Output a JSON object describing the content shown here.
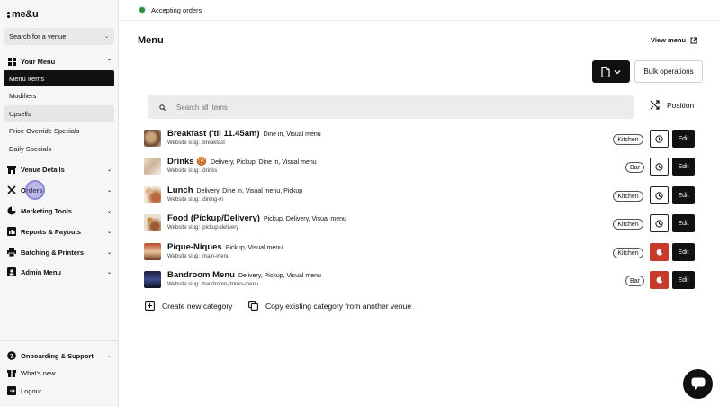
{
  "brand": {
    "logo_text": "me&u"
  },
  "sidebar": {
    "venue_placeholder": "Search for a venue",
    "sections": {
      "your_menu": "Your Menu",
      "venue_details": "Venue Details",
      "orders": "Orders",
      "marketing_tools": "Marketing Tools",
      "reports_payouts": "Reports & Payouts",
      "batching_printers": "Batching & Printers",
      "admin_menu": "Admin Menu"
    },
    "sub_items": [
      "Menu Items",
      "Modifiers",
      "Upsells",
      "Price Override Specials",
      "Daily Specials"
    ],
    "footer": {
      "onboarding": "Onboarding & Support",
      "whats_new": "What's new",
      "logout": "Logout"
    }
  },
  "topbar": {
    "status": "Accepting orders",
    "status_color": "#2e8b3e"
  },
  "main": {
    "title": "Menu",
    "view_menu": "View menu",
    "bulk_operations": "Bulk operations",
    "search_placeholder": "Search all items",
    "position_label": "Position",
    "rows": [
      {
        "name": "Breakfast ('til 11.45am)",
        "tags": "Dine in, Visual menu",
        "slug": "Website slug: /breakfast",
        "station": "Kitchen",
        "schedule": "clock"
      },
      {
        "name": "Drinks 🍪",
        "tags": "Delivery, Pickup, Dine in, Visual menu",
        "slug": "Website slug: /drinks",
        "station": "Bar",
        "schedule": "clock"
      },
      {
        "name": "Lunch",
        "tags": "Delivery, Dine in, Visual menu, Pickup",
        "slug": "Website slug: /dining-in",
        "station": "Kitchen",
        "schedule": "clock"
      },
      {
        "name": "Food (Pickup/Delivery)",
        "tags": "Pickup, Delivery, Visual menu",
        "slug": "Website slug: /pickup-delivery",
        "station": "Kitchen",
        "schedule": "clock"
      },
      {
        "name": "Pique-Niques",
        "tags": "Pickup, Visual menu",
        "slug": "Website slug: /main-menu",
        "station": "Kitchen",
        "schedule": "moon"
      },
      {
        "name": "Bandroom Menu",
        "tags": "Delivery, Pickup, Visual menu",
        "slug": "Website slug: /bandroom-drinks-menu",
        "station": "Bar",
        "schedule": "moon"
      }
    ],
    "edit_label": "Edit",
    "create_category": "Create new category",
    "copy_category": "Copy existing category from another venue"
  }
}
